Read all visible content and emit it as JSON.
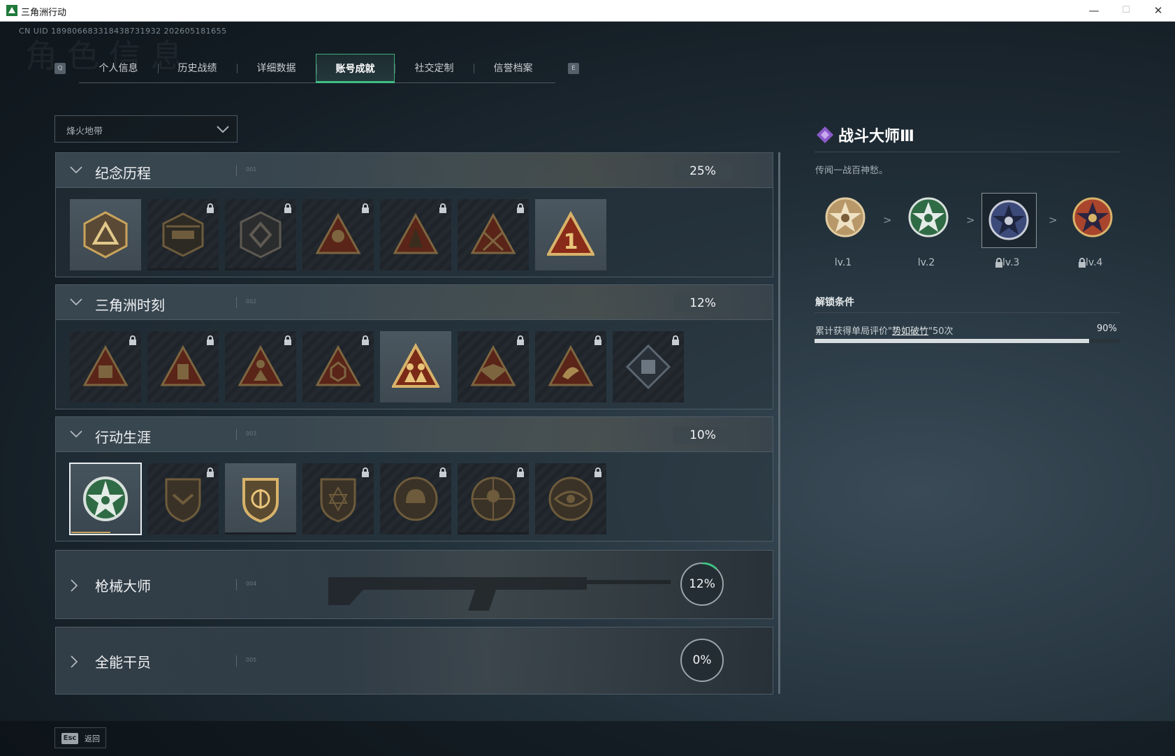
{
  "window": {
    "title": "三角洲行动",
    "minimize": "—",
    "maximize": "☐",
    "close": "✕"
  },
  "uid": "CN UID 1898066833184387319​32 202605181655",
  "bg_title": "角色信息",
  "tabs": {
    "left_key": "Q",
    "right_key": "E",
    "items": [
      {
        "label": "个人信息"
      },
      {
        "label": "历史战绩"
      },
      {
        "label": "详细数据"
      },
      {
        "label": "账号成就"
      },
      {
        "label": "社交定制"
      },
      {
        "label": "信誉档案"
      }
    ],
    "active": 3
  },
  "dropdown": {
    "value": "烽火地带"
  },
  "sections": [
    {
      "title": "纪念历程",
      "num": "001",
      "progress": "25%",
      "expanded": true
    },
    {
      "title": "三角洲时刻",
      "num": "002",
      "progress": "12%",
      "expanded": true
    },
    {
      "title": "行动生涯",
      "num": "003",
      "progress": "10%",
      "expanded": true
    },
    {
      "title": "枪械大师",
      "num": "004",
      "progress": "12%",
      "progress_value": 0.12,
      "expanded": false
    },
    {
      "title": "全能干员",
      "num": "005",
      "progress": "0%",
      "progress_value": 0,
      "expanded": false
    }
  ],
  "detail": {
    "title": "战斗大师Ⅲ",
    "description": "传闻一战百神愁。",
    "levels": [
      {
        "label": "lv.1",
        "locked": false,
        "color": "#c8a878"
      },
      {
        "label": "lv.2",
        "locked": false,
        "color": "#3f9a5a"
      },
      {
        "label": "lv.3",
        "locked": true,
        "color": "#3c4a7a"
      },
      {
        "label": "lv.4",
        "locked": true,
        "color": "#a8452c"
      }
    ],
    "separator": ">",
    "unlock_heading": "解锁条件",
    "requirement_prefix": "累计获得单局评价\"",
    "requirement_link": "势如破竹",
    "requirement_suffix": "\"50次",
    "progress_text": "90%",
    "progress_value": 0.9
  },
  "footer": {
    "key": "Esc",
    "label": "返回"
  },
  "colors": {
    "accent_green": "#3fbf83",
    "gold": "#c9a45c",
    "dark_red": "#6b2418"
  }
}
